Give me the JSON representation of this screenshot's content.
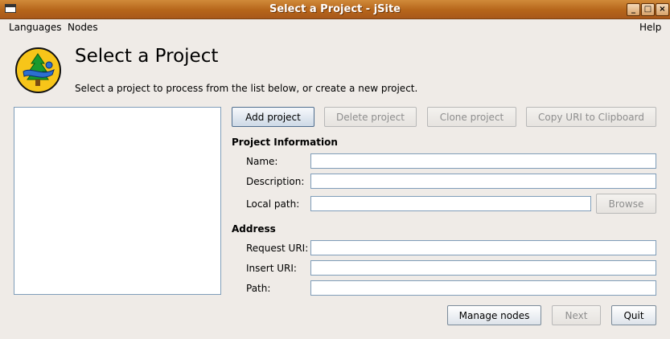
{
  "window": {
    "title": "Select a Project - jSite"
  },
  "menubar": {
    "languages": "Languages",
    "nodes": "Nodes",
    "help": "Help"
  },
  "header": {
    "title": "Select a Project",
    "subtitle": "Select a project to process from the list below, or create a new project."
  },
  "actions": {
    "add": "Add project",
    "delete": "Delete project",
    "clone": "Clone project",
    "copy_uri": "Copy URI to Clipboard"
  },
  "project_info": {
    "heading": "Project Information",
    "name_label": "Name:",
    "name_value": "",
    "description_label": "Description:",
    "description_value": "",
    "local_path_label": "Local path:",
    "local_path_value": "",
    "browse": "Browse"
  },
  "address": {
    "heading": "Address",
    "request_uri_label": "Request URI:",
    "request_uri_value": "",
    "insert_uri_label": "Insert URI:",
    "insert_uri_value": "",
    "path_label": "Path:",
    "path_value": ""
  },
  "footer": {
    "manage_nodes": "Manage nodes",
    "next": "Next",
    "quit": "Quit"
  }
}
